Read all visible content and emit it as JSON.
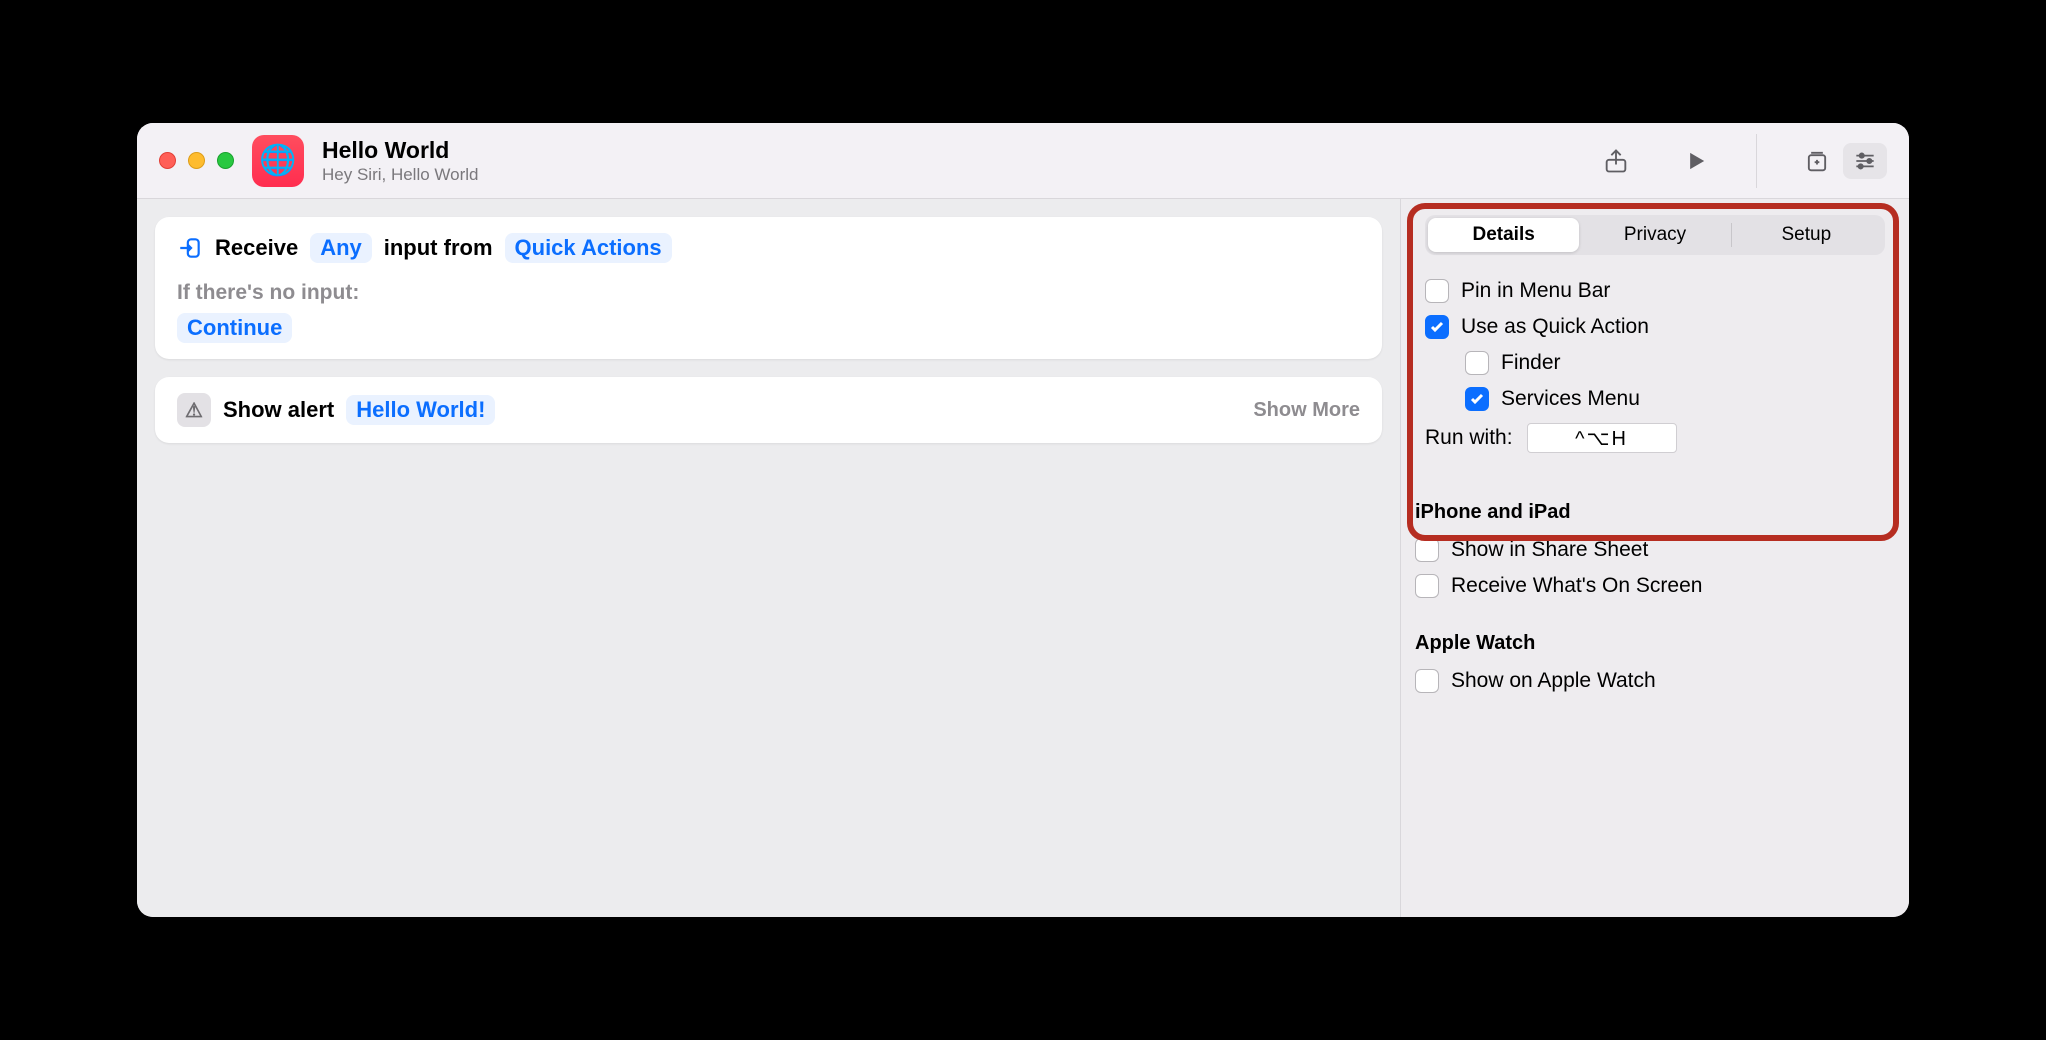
{
  "title": {
    "name": "Hello World",
    "subtitle": "Hey Siri, Hello World"
  },
  "actions": {
    "receive": {
      "label_receive": "Receive",
      "any_token": "Any",
      "label_from": "input from",
      "source_token": "Quick Actions",
      "noinput_label": "If there's no input:",
      "continue_token": "Continue"
    },
    "alert": {
      "label": "Show alert",
      "text_token": "Hello World!",
      "more_label": "Show More"
    }
  },
  "inspector": {
    "tabs": {
      "details": "Details",
      "privacy": "Privacy",
      "setup": "Setup"
    },
    "pin_menu": "Pin in Menu Bar",
    "quick_action": "Use as Quick Action",
    "finder": "Finder",
    "services_menu": "Services Menu",
    "run_with_label": "Run with:",
    "run_with_value": "^⌥H",
    "iphone_head": "iPhone and iPad",
    "share_sheet": "Show in Share Sheet",
    "receive_screen": "Receive What's On Screen",
    "watch_head": "Apple Watch",
    "show_watch": "Show on Apple Watch"
  }
}
